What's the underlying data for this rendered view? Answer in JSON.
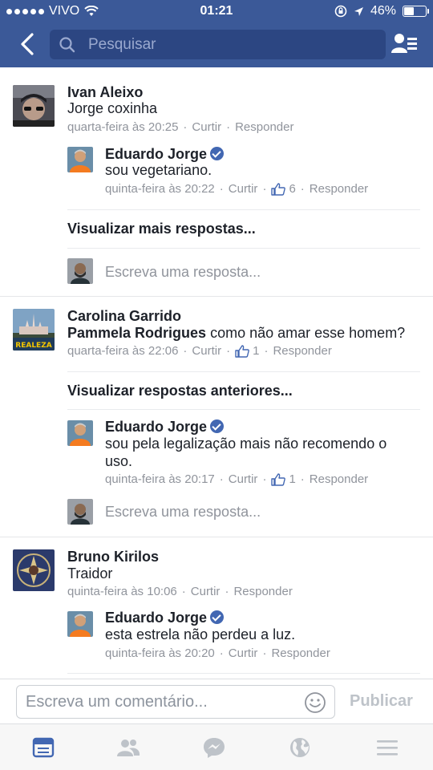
{
  "status_bar": {
    "carrier": "VIVO",
    "time": "01:21",
    "battery_percent": "46%",
    "battery_level": 0.46
  },
  "header": {
    "search_placeholder": "Pesquisar"
  },
  "threads": [
    {
      "author": "Ivan Aleixo",
      "text": "Jorge coxinha",
      "time": "quarta-feira às 20:25",
      "like_label": "Curtir",
      "reply_label": "Responder",
      "replies": [
        {
          "author": "Eduardo Jorge",
          "text": "sou vegetariano.",
          "time": "quinta-feira às 20:22",
          "like_label": "Curtir",
          "likes": "6",
          "reply_label": "Responder"
        }
      ],
      "more_label": "Visualizar mais respostas...",
      "reply_placeholder": "Escreva uma resposta..."
    },
    {
      "author": "Carolina Garrido",
      "mention": "Pammela Rodrigues",
      "text": "como não amar esse homem?",
      "time": "quarta-feira às 22:06",
      "like_label": "Curtir",
      "likes": "1",
      "reply_label": "Responder",
      "avatar_text": "REALEZA",
      "more_label": "Visualizar respostas anteriores...",
      "replies": [
        {
          "author": "Eduardo Jorge",
          "text_line1": "sou pela legalização mais não recomendo o",
          "text_line2": "uso.",
          "time": "quinta-feira às 20:17",
          "like_label": "Curtir",
          "likes": "1",
          "reply_label": "Responder"
        }
      ],
      "reply_placeholder": "Escreva uma resposta..."
    },
    {
      "author": "Bruno Kirilos",
      "text": "Traidor",
      "time": "quinta-feira às 10:06",
      "like_label": "Curtir",
      "reply_label": "Responder",
      "replies": [
        {
          "author": "Eduardo Jorge",
          "text": "esta estrela não perdeu a luz.",
          "time": "quinta-feira às 20:20",
          "like_label": "Curtir",
          "reply_label": "Responder"
        }
      ]
    }
  ],
  "composer": {
    "placeholder": "Escreva um comentário...",
    "publish_label": "Publicar"
  },
  "tabbar": {
    "tabs": [
      "news-feed-icon",
      "friends-icon",
      "messenger-icon",
      "globe-icon",
      "menu-icon"
    ],
    "active": "news-feed-icon"
  },
  "colors": {
    "brand": "#3b5998",
    "search_bg": "#2c4682",
    "meta": "#90949c",
    "verified": "#4267b2",
    "active_tab": "#4267b2",
    "inactive_tab": "#bec3c9"
  }
}
